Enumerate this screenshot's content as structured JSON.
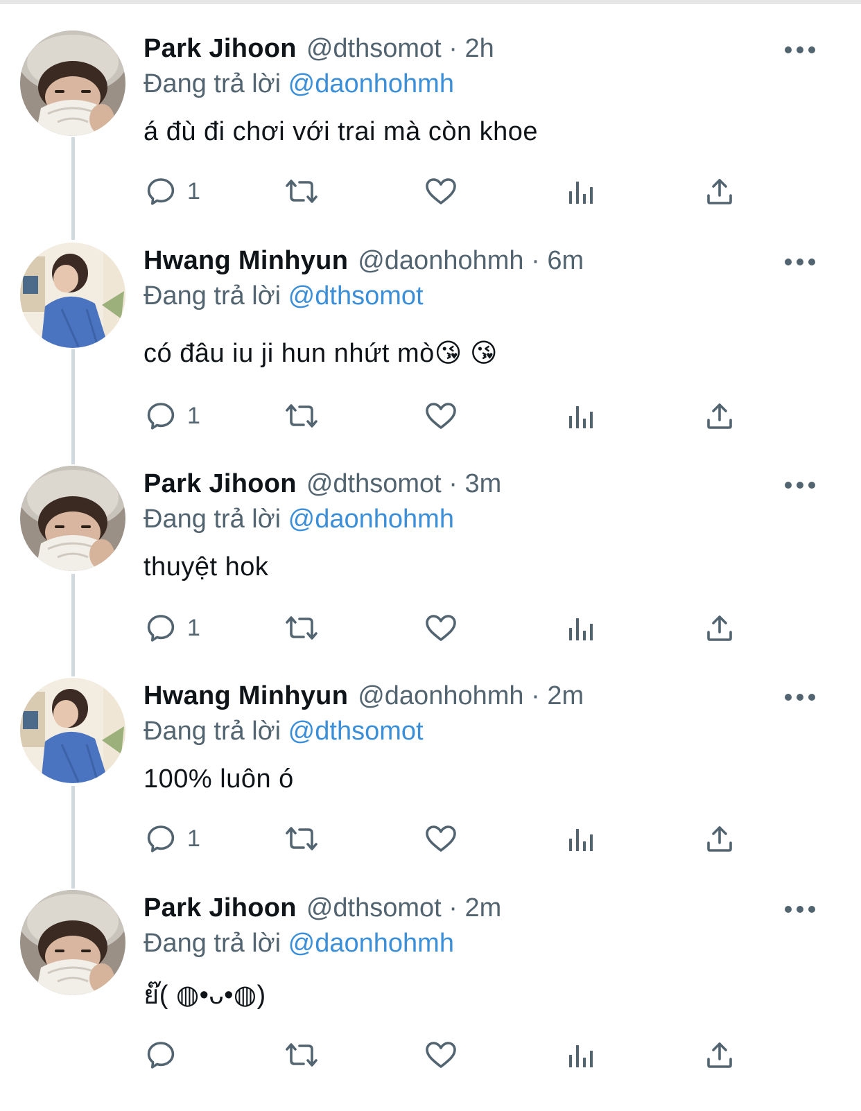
{
  "tweets": [
    {
      "name": "Park Jihoon",
      "handle": "@dthsomot",
      "separator": "·",
      "time": "2h",
      "reply_prefix": "Đang trả lời",
      "reply_to": "@daonhohmh",
      "text": "á đù đi chơi với trai mà còn khoe",
      "reply_count": "1",
      "avatar": "park-jihoon"
    },
    {
      "name": "Hwang Minhyun",
      "handle": "@daonhohmh",
      "separator": "·",
      "time": "6m",
      "reply_prefix": "Đang trả lời",
      "reply_to": "@dthsomot",
      "text": "có đâu iu ji hun nhứt mò😘 😘",
      "reply_count": "1",
      "avatar": "hwang-minhyun"
    },
    {
      "name": "Park Jihoon",
      "handle": "@dthsomot",
      "separator": "·",
      "time": "3m",
      "reply_prefix": "Đang trả lời",
      "reply_to": "@daonhohmh",
      "text": "thuyệt hok",
      "reply_count": "1",
      "avatar": "park-jihoon"
    },
    {
      "name": "Hwang Minhyun",
      "handle": "@daonhohmh",
      "separator": "·",
      "time": "2m",
      "reply_prefix": "Đang trả lời",
      "reply_to": "@dthsomot",
      "text": "100% luôn ó",
      "reply_count": "1",
      "avatar": "hwang-minhyun"
    },
    {
      "name": "Park Jihoon",
      "handle": "@dthsomot",
      "separator": "·",
      "time": "2m",
      "reply_prefix": "Đang trả lời",
      "reply_to": "@daonhohmh",
      "text": "ย๊( ◍•ᴗ•◍)",
      "reply_count": "",
      "avatar": "park-jihoon"
    }
  ],
  "icons": {
    "reply": "reply-icon",
    "retweet": "retweet-icon",
    "like": "heart-icon",
    "analytics": "analytics-icon",
    "share": "share-icon",
    "more": "more-icon"
  },
  "colors": {
    "text": "#0f1419",
    "secondary": "#536471",
    "mention": "#3b8fd9",
    "thread_line": "#cfd9de"
  }
}
